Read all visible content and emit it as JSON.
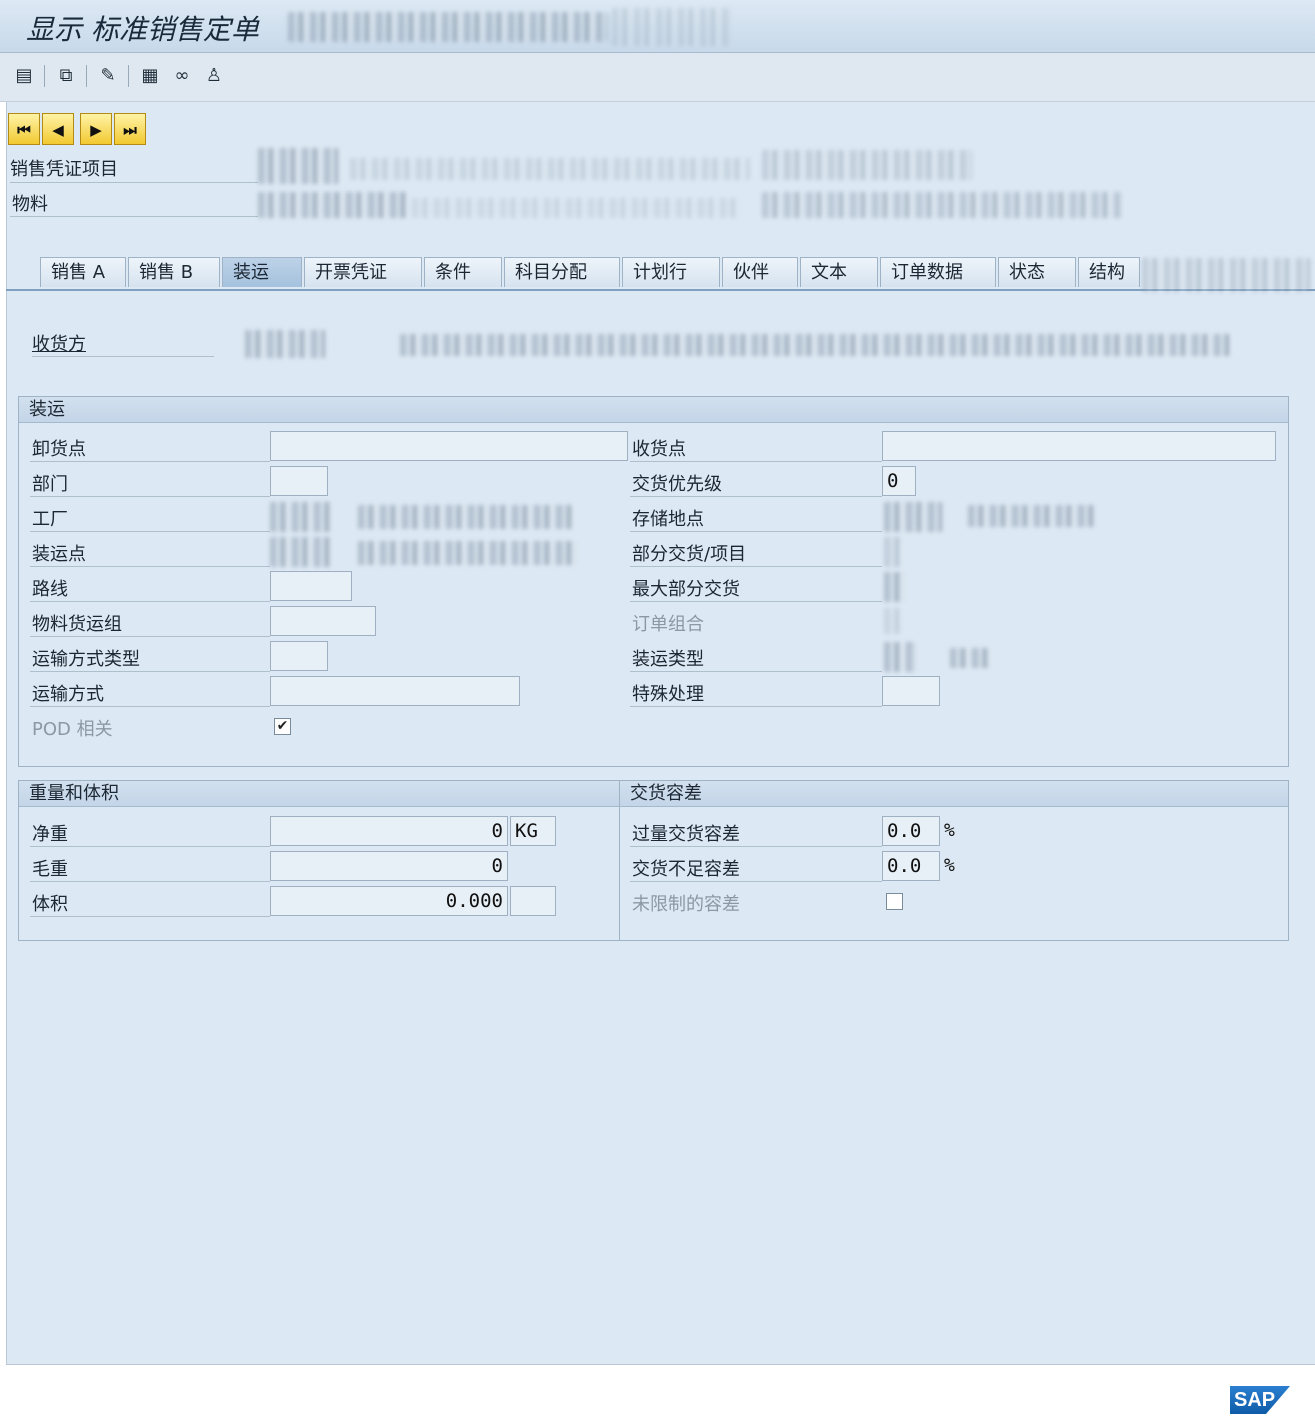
{
  "window": {
    "title": "显示 标准销售定单"
  },
  "nav_buttons": {
    "first": "⏮",
    "prev": "◀",
    "next": "▶",
    "last": "⏭"
  },
  "header": {
    "item_label": "销售凭证项目",
    "material_label": "物料"
  },
  "tabs": [
    {
      "label": "销售 A"
    },
    {
      "label": "销售 B"
    },
    {
      "label": "装运"
    },
    {
      "label": "开票凭证"
    },
    {
      "label": "条件"
    },
    {
      "label": "科目分配"
    },
    {
      "label": "计划行"
    },
    {
      "label": "伙伴"
    },
    {
      "label": "文本"
    },
    {
      "label": "订单数据"
    },
    {
      "label": "状态"
    },
    {
      "label": "结构"
    }
  ],
  "ship_to": {
    "label": "收货方"
  },
  "shipping": {
    "title": "装运",
    "unloading_point": "卸货点",
    "department": "部门",
    "plant": "工厂",
    "shipping_point": "装运点",
    "route": "路线",
    "material_freight_group": "物料货运组",
    "means_of_transport_type": "运输方式类型",
    "means_of_transport": "运输方式",
    "pod_relevant": "POD 相关",
    "receiving_point": "收货点",
    "delivery_priority": "交货优先级",
    "delivery_priority_value": "0",
    "storage_location": "存储地点",
    "partial_delivery": "部分交货/项目",
    "max_partial_deliveries": "最大部分交货",
    "order_combination": "订单组合",
    "shipping_type": "装运类型",
    "special_processing": "特殊处理"
  },
  "weight_volume": {
    "title": "重量和体积",
    "net_weight": "净重",
    "net_weight_value": "0",
    "net_weight_unit": "KG",
    "gross_weight": "毛重",
    "gross_weight_value": "0",
    "volume": "体积",
    "volume_value": "0.000"
  },
  "delivery_tolerance": {
    "title": "交货容差",
    "over_delivery": "过量交货容差",
    "over_delivery_value": "0.0",
    "under_delivery": "交货不足容差",
    "under_delivery_value": "0.0",
    "percent": "%",
    "unlimited": "未限制的容差"
  },
  "brand": {
    "logo": "SAP"
  }
}
